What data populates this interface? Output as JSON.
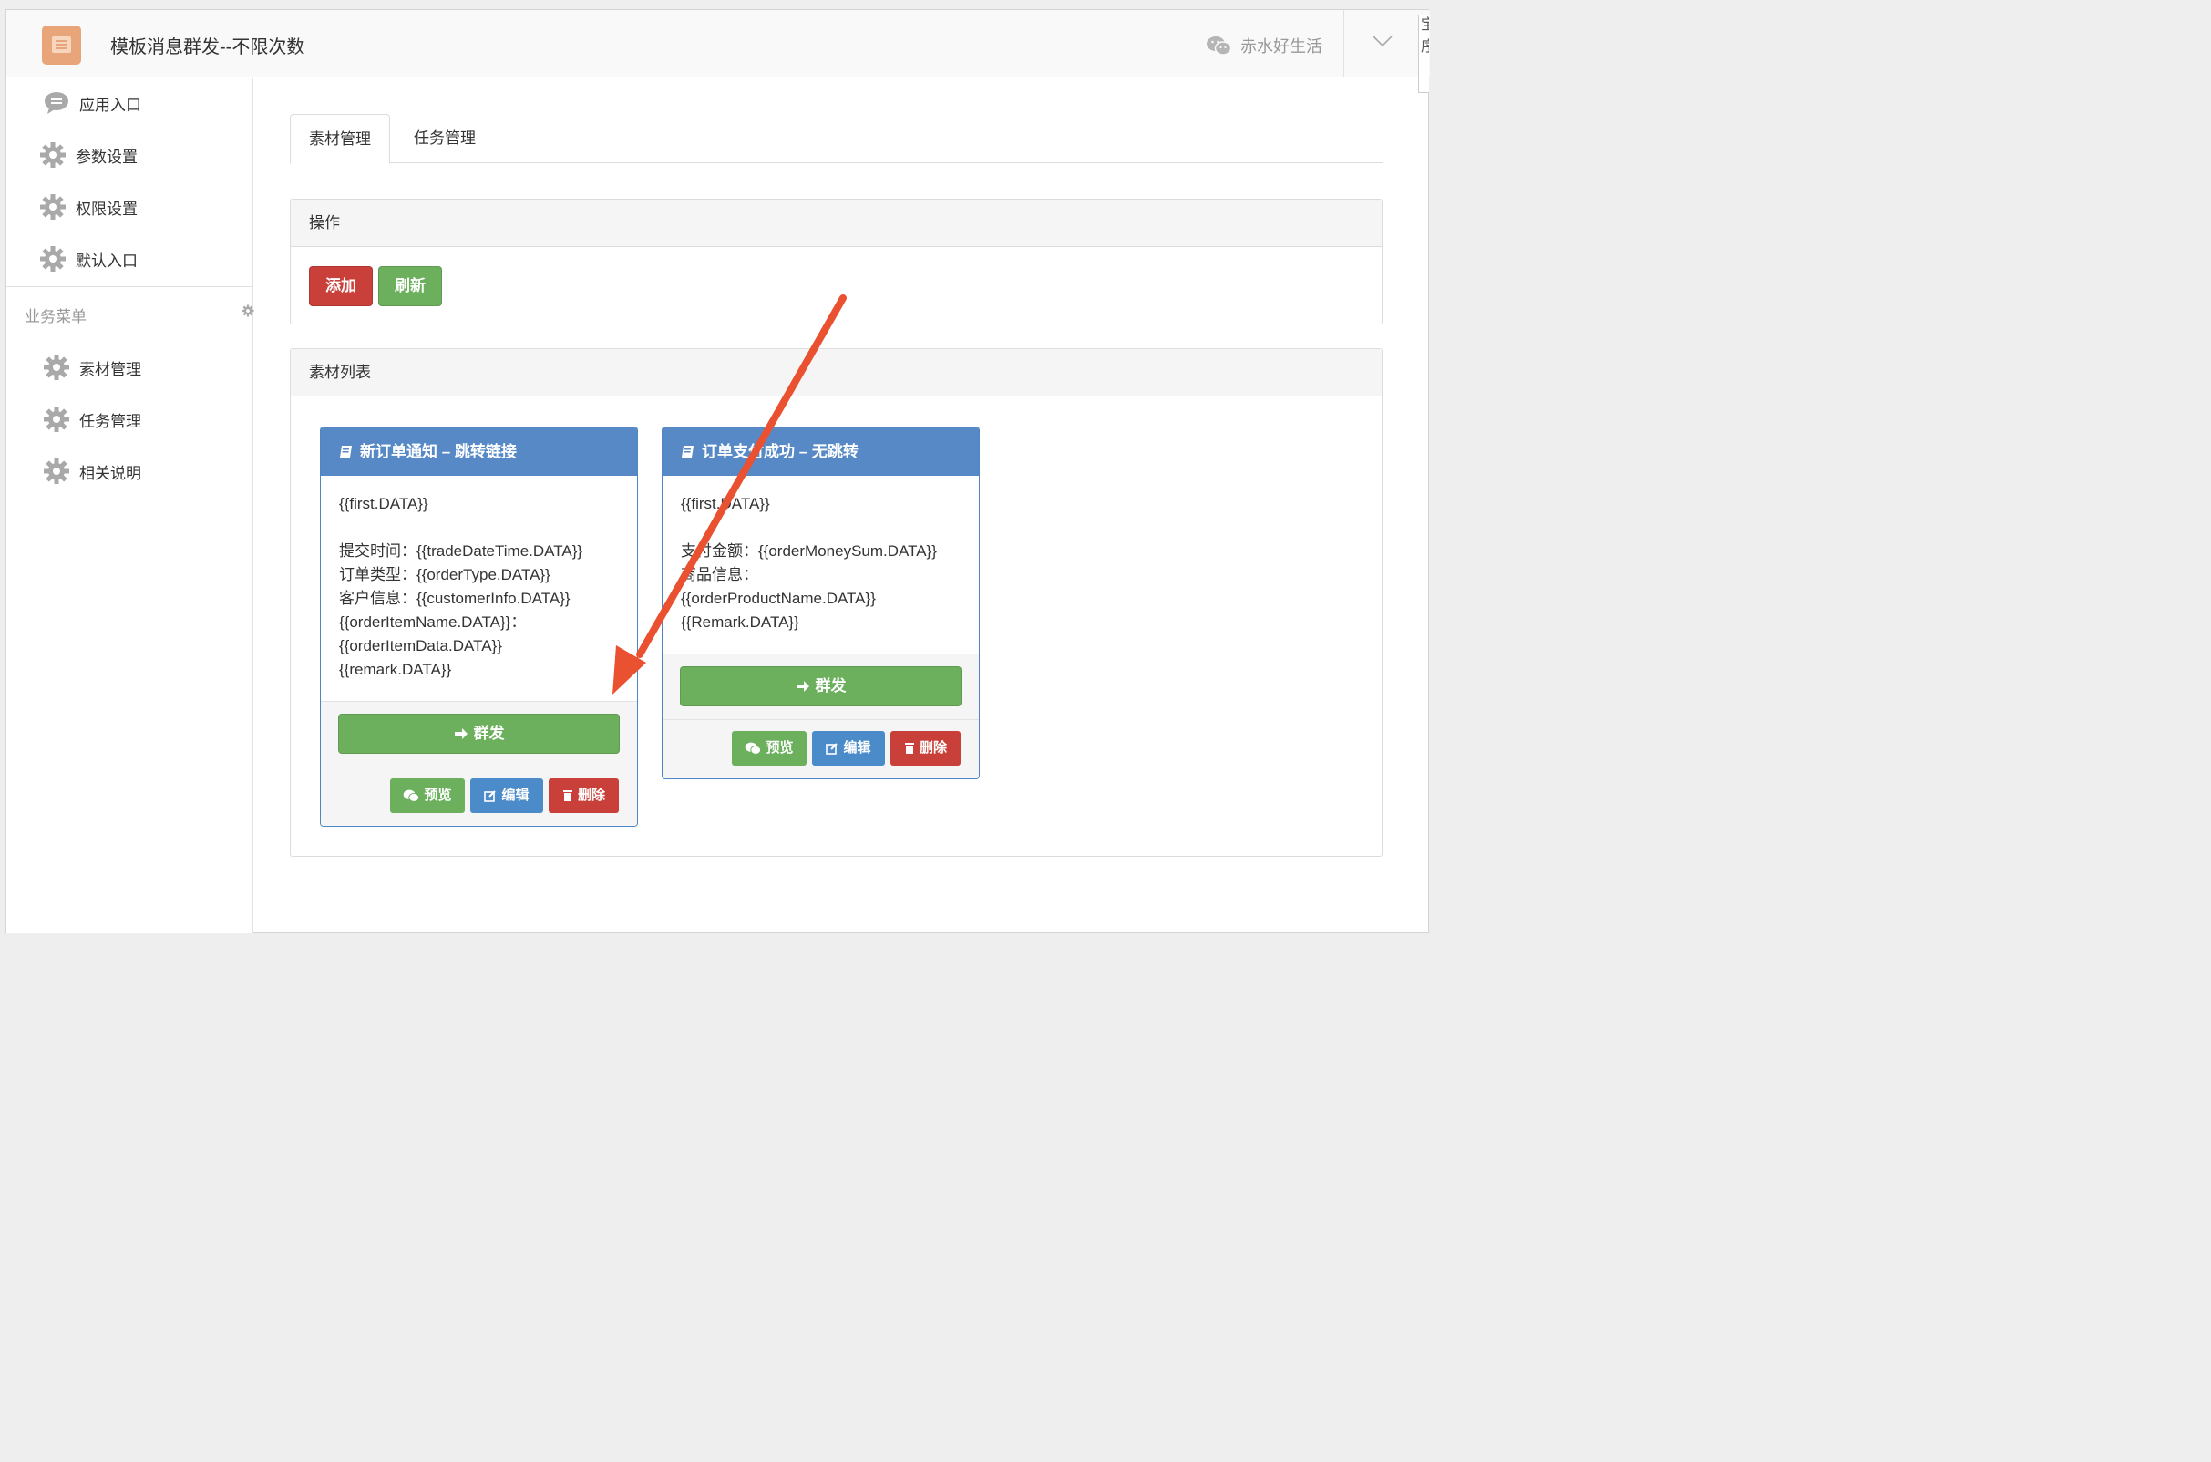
{
  "header": {
    "title": "模板消息群发--不限次数",
    "user_name": "赤水好生活"
  },
  "edge_window": {
    "chars": [
      "宝",
      "序"
    ]
  },
  "sidebar": {
    "top_items": [
      {
        "label": "应用入口",
        "icon": "chat-bubble-icon"
      },
      {
        "label": "参数设置",
        "icon": "gear-icon"
      },
      {
        "label": "权限设置",
        "icon": "gear-icon"
      },
      {
        "label": "默认入口",
        "icon": "gear-icon"
      }
    ],
    "section_label": "业务菜单",
    "biz_items": [
      {
        "label": "素材管理",
        "icon": "gear-icon"
      },
      {
        "label": "任务管理",
        "icon": "gear-icon"
      },
      {
        "label": "相关说明",
        "icon": "gear-icon"
      }
    ]
  },
  "tabs": [
    {
      "label": "素材管理",
      "active": true
    },
    {
      "label": "任务管理",
      "active": false
    }
  ],
  "operations_panel": {
    "title": "操作",
    "add_label": "添加",
    "refresh_label": "刷新"
  },
  "materials_panel": {
    "title": "素材列表",
    "cards": [
      {
        "title": "新订单通知 – 跳转链接",
        "body": "{{first.DATA}}\n\n提交时间：{{tradeDateTime.DATA}}\n订单类型：{{orderType.DATA}}\n客户信息：{{customerInfo.DATA}}\n{{orderItemName.DATA}}：\n{{orderItemData.DATA}}\n{{remark.DATA}}",
        "send_label": "群发",
        "preview_label": "预览",
        "edit_label": "编辑",
        "delete_label": "删除"
      },
      {
        "title": "订单支付成功 – 无跳转",
        "body": "{{first.DATA}}\n\n支付金额：{{orderMoneySum.DATA}}\n商品信息：\n{{orderProductName.DATA}}\n{{Remark.DATA}}",
        "send_label": "群发",
        "preview_label": "预览",
        "edit_label": "编辑",
        "delete_label": "删除"
      }
    ]
  },
  "colors": {
    "accent_orange": "#e8a579",
    "danger": "#c9403a",
    "success": "#6cb05e",
    "primary": "#4c8bc9",
    "card_header": "#5789c7",
    "annotation_arrow": "#ea5130"
  }
}
